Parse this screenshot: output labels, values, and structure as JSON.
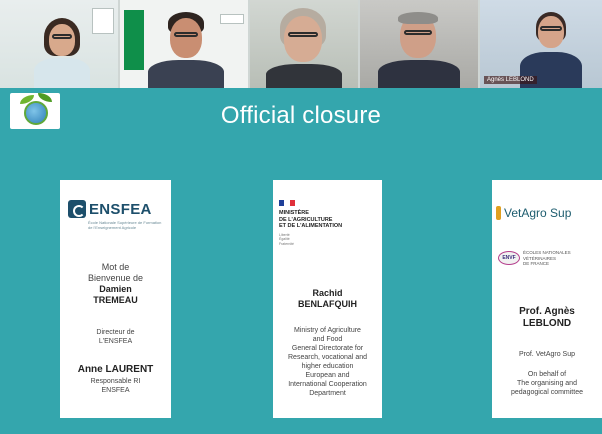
{
  "video_call": {
    "participants": [
      {
        "name_tag": ""
      },
      {
        "name_tag": ""
      },
      {
        "name_tag": ""
      },
      {
        "name_tag": ""
      },
      {
        "name_tag": "Agnès LEBLOND"
      }
    ]
  },
  "slide": {
    "title": "Official closure",
    "panels": [
      {
        "logo_text": "ENSFEA",
        "logo_subtitle": "École Nationale Supérieure de Formation de l'Enseignement Agricole",
        "intro": [
          "Mot de",
          "Bienvenue de"
        ],
        "speaker": [
          "Damien",
          "TREMEAU"
        ],
        "role": [
          "Directeur de",
          "L'ENSFEA"
        ],
        "speaker2": "Anne LAURENT",
        "role2": [
          "Responsable RI",
          "ENSFEA"
        ]
      },
      {
        "logo_lines": [
          "MINISTÈRE",
          "DE L'AGRICULTURE",
          "ET DE L'ALIMENTATION"
        ],
        "motto": [
          "Liberté",
          "Égalité",
          "Fraternité"
        ],
        "speaker": [
          "Rachid",
          "BENLAFQUIH"
        ],
        "role": [
          "Ministry of Agriculture",
          "and Food",
          "General Directorate for",
          "Research, vocational and",
          "higher education",
          "European and",
          "International Cooperation",
          "Department"
        ]
      },
      {
        "logo_text": "VetAgro Sup",
        "logo2_mark": "ENVF",
        "logo2_lines": [
          "ÉCOLES NATIONALES",
          "VÉTÉRINAIRES",
          "DE FRANCE"
        ],
        "speaker": [
          "Prof. Agnès",
          "LEBLOND"
        ],
        "role": "Prof. VetAgro Sup",
        "behalf": [
          "On behalf of",
          "The organising and",
          "pedagogical committee"
        ]
      }
    ]
  },
  "colors": {
    "slide_background": "#34a6ad",
    "panel_background": "#ffffff",
    "title_color": "#ffffff",
    "ensfea_blue": "#1d4f6b",
    "flag_blue": "#1f3f99",
    "flag_red": "#e0303a"
  }
}
